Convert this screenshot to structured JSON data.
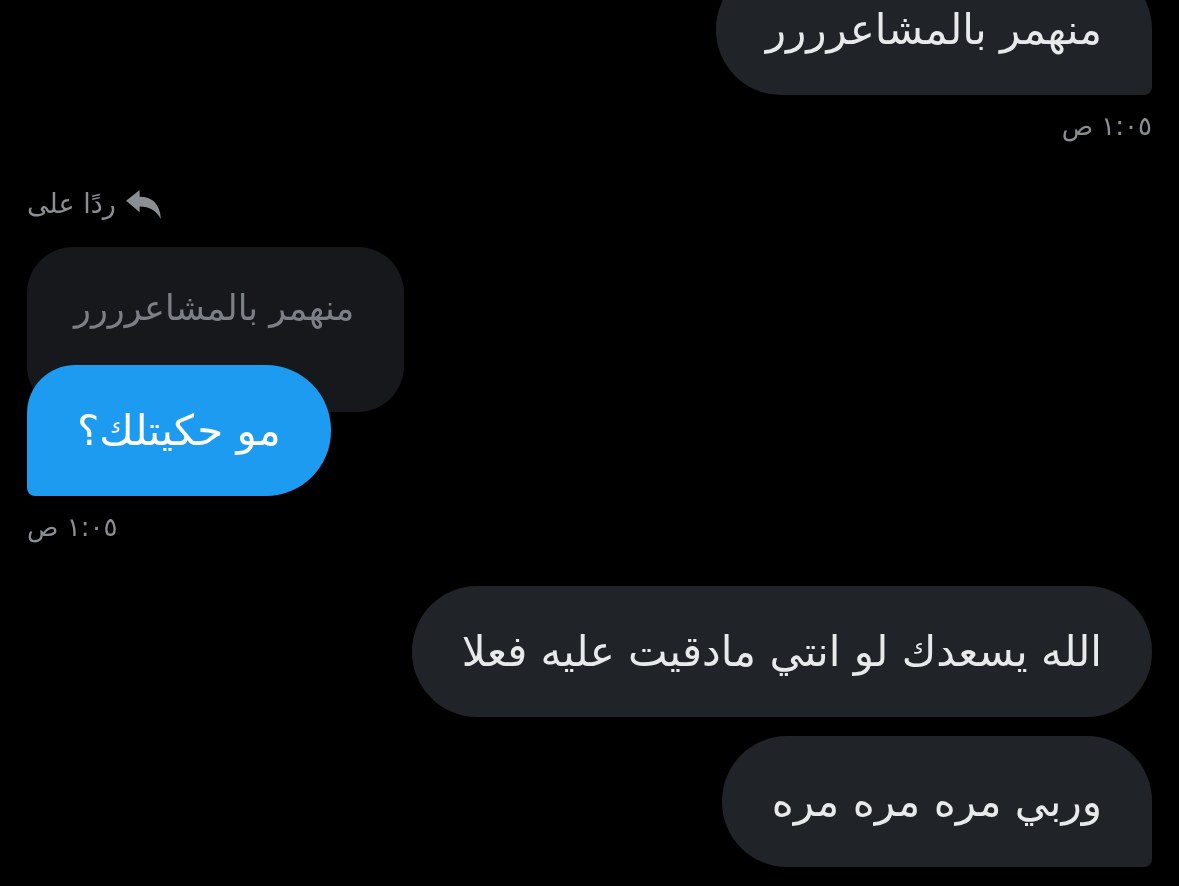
{
  "conversation": [
    {
      "kind": "message",
      "sent": false,
      "text": "منهمر بالمشاعرررر"
    },
    {
      "kind": "timestamp",
      "sent": false,
      "text": "١:٠٥ ص"
    },
    {
      "kind": "reply",
      "sent": true,
      "label": "ردًا على",
      "quoted": "منهمر بالمشاعرررر",
      "text": "مو حكيتلك؟"
    },
    {
      "kind": "timestamp",
      "sent": true,
      "text": "١:٠٥ ص"
    },
    {
      "kind": "message",
      "sent": false,
      "text": "الله يسعدك لو انتي مادقيت عليه فعلا"
    },
    {
      "kind": "message",
      "sent": false,
      "text": "وربي مره مره مره"
    }
  ]
}
